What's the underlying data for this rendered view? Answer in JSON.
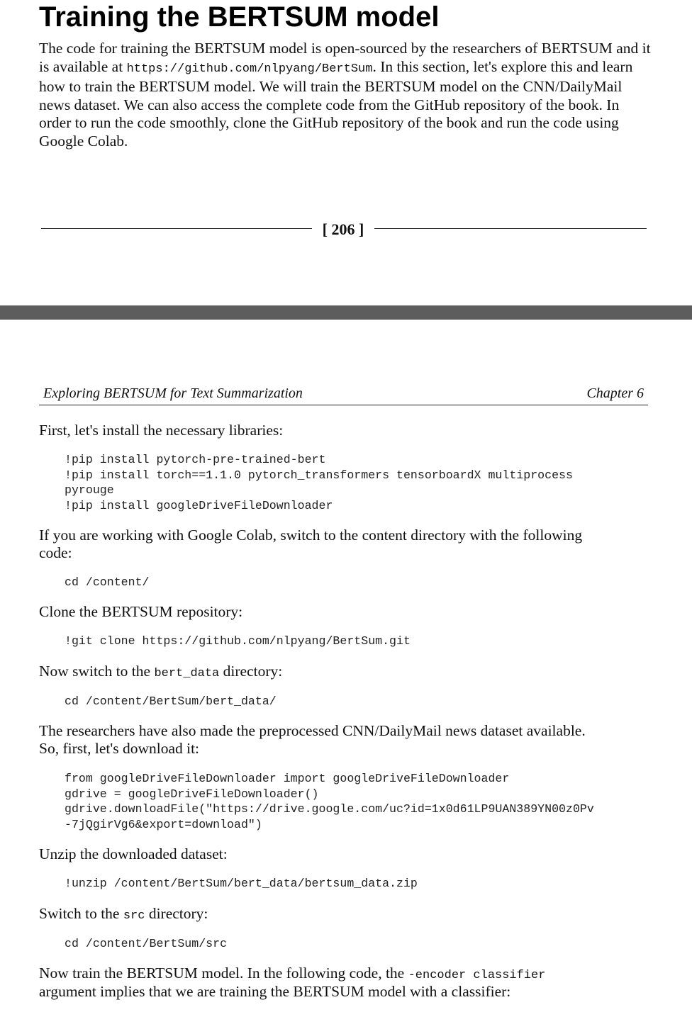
{
  "page1": {
    "heading": "Training the BERTSUM model",
    "intro_a": "The code for training the BERTSUM model is open-sourced by the researchers of BERTSUM and it is available at ",
    "intro_url": "https://github.com/nlpyang/BertSum",
    "intro_b": ". In this section, let's explore this and learn how to train the BERTSUM model. We will train the BERTSUM model on the CNN/DailyMail news dataset. We can also access the complete code from the GitHub repository of the book. In order to run the code smoothly, clone the GitHub repository of the book and run the code using Google Colab.",
    "page_number": "[ 206 ]"
  },
  "page2": {
    "running_header_left": "Exploring BERTSUM for Text Summarization",
    "running_header_right": "Chapter 6",
    "p_install": "First, let's install the necessary libraries:",
    "code_install": "!pip install pytorch-pre-trained-bert\n!pip install torch==1.1.0 pytorch_transformers tensorboardX multiprocess\npyrouge\n!pip install googleDriveFileDownloader",
    "p_colab_l1": "If you are working with Google Colab, switch to the content directory with the following",
    "p_colab_l2": "code:",
    "code_cd_content": "cd /content/",
    "p_clone": "Clone the BERTSUM repository:",
    "code_clone": "!git clone https://github.com/nlpyang/BertSum.git",
    "p_switch_a": "Now switch to the ",
    "p_switch_code": "bert_data",
    "p_switch_b": " directory:",
    "code_cd_bertdata": "cd /content/BertSum/bert_data/",
    "p_dataset_l1": "The researchers have also made the preprocessed CNN/DailyMail news dataset available.",
    "p_dataset_l2": "So, first, let's download it:",
    "code_download": "from googleDriveFileDownloader import googleDriveFileDownloader\ngdrive = googleDriveFileDownloader()\ngdrive.downloadFile(\"https://drive.google.com/uc?id=1x0d61LP9UAN389YN00z0Pv\n-7jQgirVg6&export=download\")",
    "p_unzip": "Unzip the downloaded dataset:",
    "code_unzip": "!unzip /content/BertSum/bert_data/bertsum_data.zip",
    "p_src_a": "Switch to the ",
    "p_src_code": "src",
    "p_src_b": " directory:",
    "code_cd_src": "cd /content/BertSum/src",
    "p_train_a": "Now train the BERTSUM model. In the following code, the ",
    "p_train_code": "-encoder classifier",
    "p_train_l2": "argument implies that we are training the BERTSUM model with a classifier:"
  },
  "colors": {
    "separator": "#5d5d5d",
    "text": "#111111"
  }
}
